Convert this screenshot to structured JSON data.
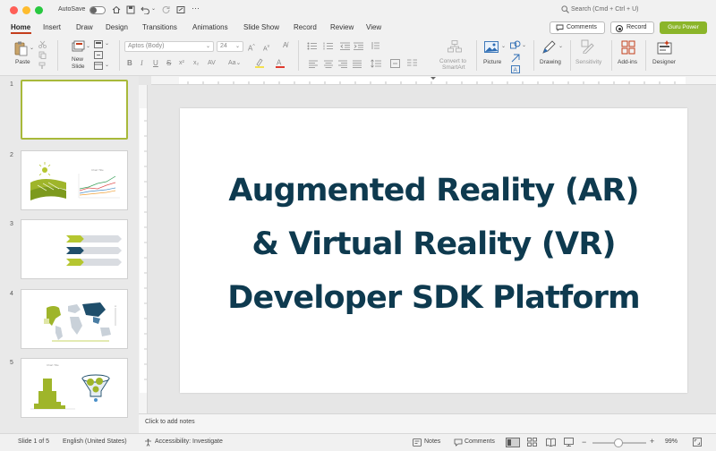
{
  "titlebar": {
    "autosave_label": "AutoSave",
    "more_label": "···",
    "search_placeholder": "Search (Cmd + Ctrl + U)"
  },
  "ribbon_tabs": [
    "Home",
    "Insert",
    "Draw",
    "Design",
    "Transitions",
    "Animations",
    "Slide Show",
    "Record",
    "Review",
    "View"
  ],
  "actions": {
    "comments_label": "Comments",
    "record_label": "Record",
    "guru_label": "Guru Power"
  },
  "ribbon": {
    "paste_label": "Paste",
    "new_slide_label_1": "New",
    "new_slide_label_2": "Slide",
    "font_family": "Aptos (Body)",
    "font_size": "24",
    "convert_label_1": "Convert to",
    "convert_label_2": "SmartArt",
    "picture_label": "Picture",
    "drawing_label": "Drawing",
    "sensitivity_label": "Sensitivity",
    "addins_label": "Add-ins",
    "designer_label": "Designer"
  },
  "slides": [
    {
      "num": "1"
    },
    {
      "num": "2"
    },
    {
      "num": "3"
    },
    {
      "num": "4"
    },
    {
      "num": "5"
    }
  ],
  "slide": {
    "title_lines": [
      "Augmented Reality (AR)",
      "& Virtual Reality (VR)",
      "Developer SDK Platform"
    ]
  },
  "notes": {
    "placeholder": "Click to add notes"
  },
  "status": {
    "slide_info": "Slide 1 of 5",
    "language": "English (United States)",
    "accessibility": "Accessibility: Investigate",
    "notes_label": "Notes",
    "comments_label": "Comments",
    "zoom": "99%"
  },
  "colors": {
    "accent": "#b5c630",
    "title": "#0e3a4f",
    "home_tab": "#c43e1c",
    "guru_button": "#8bb52a"
  }
}
